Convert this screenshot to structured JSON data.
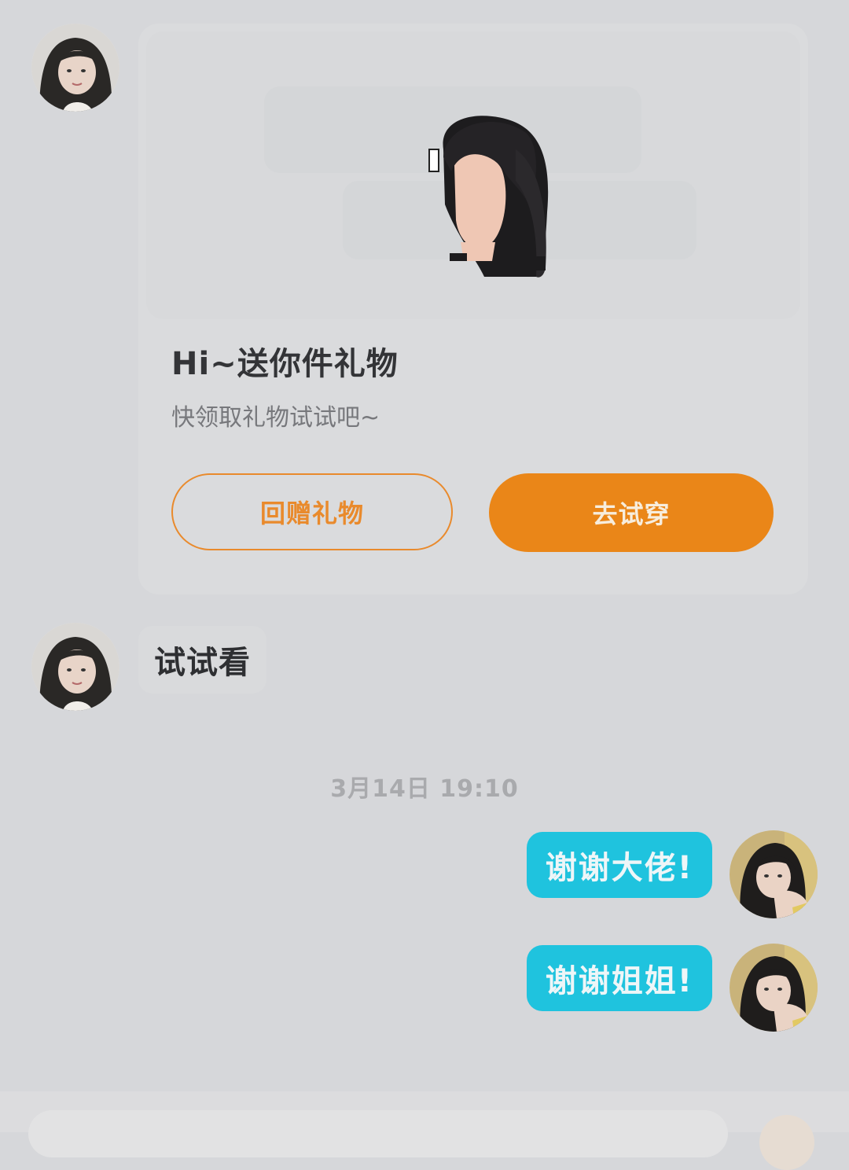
{
  "gift_card": {
    "title": "Hi~送你件礼物",
    "subtitle": "快领取礼物试试吧~",
    "return_gift_label": "回赠礼物",
    "try_on_label": "去试穿"
  },
  "messages": {
    "incoming_text": "试试看",
    "timestamp": "3月14日 19:10",
    "outgoing": [
      {
        "text": "谢谢大佬!"
      },
      {
        "text": "谢谢姐姐!"
      }
    ]
  },
  "colors": {
    "background": "#d6d7da",
    "accent_orange": "#ea8618",
    "outgoing_bubble": "#1fc3de"
  },
  "icons": {
    "gift_preview": "hair-wig-icon",
    "avatar": "user-avatar"
  }
}
